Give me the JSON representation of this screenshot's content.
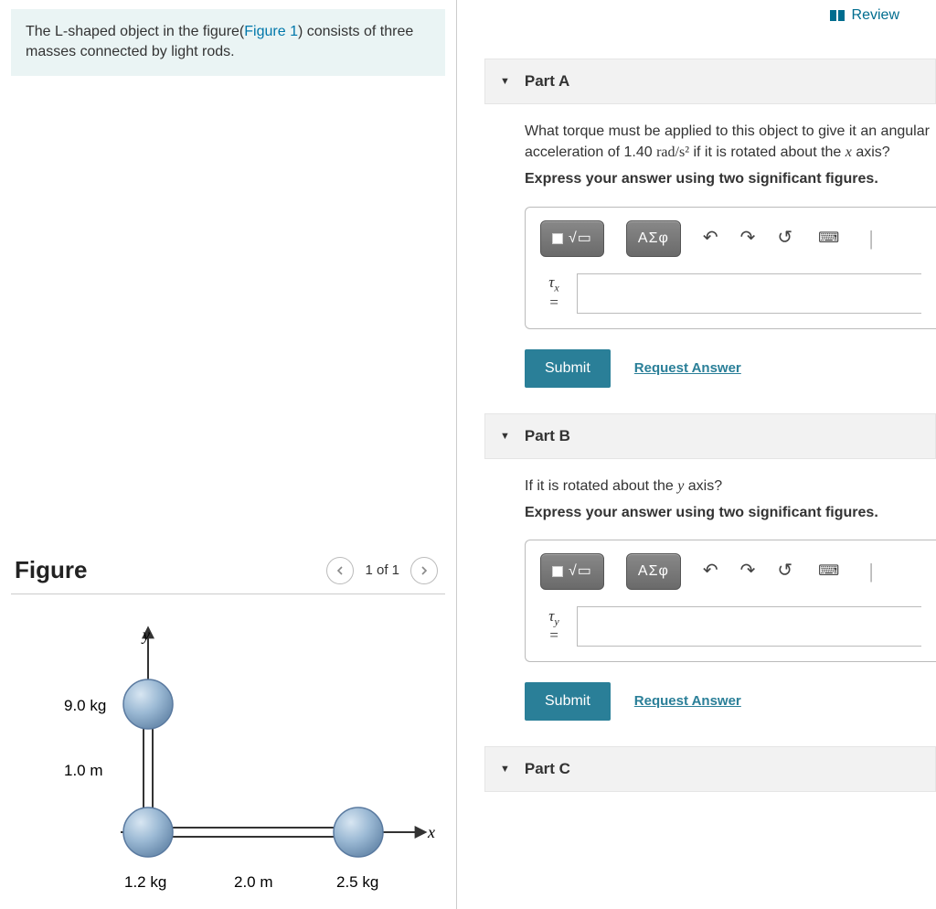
{
  "problem": {
    "text_pre": "The L-shaped object in the figure(",
    "figure_ref": "Figure 1",
    "text_post": ") consists of three masses connected by light rods."
  },
  "figure": {
    "title": "Figure",
    "pager": "1 of 1",
    "labels": {
      "y_axis": "y",
      "x_axis": "x",
      "mass_top": "9.0 kg",
      "mass_origin": "1.2 kg",
      "mass_right": "2.5 kg",
      "len_vert": "1.0 m",
      "len_horiz": "2.0 m"
    }
  },
  "review_label": "Review",
  "toolbar": {
    "math_label": "√▭",
    "greek_label": "ΑΣφ"
  },
  "parts": {
    "a": {
      "title": "Part A",
      "question_1": "What torque must be applied to this object to give it an angular acceleration of 1.40 ",
      "question_units": "rad/s²",
      "question_2": " if it is rotated about the ",
      "question_axis": "x",
      "question_3": " axis?",
      "instruction": "Express your answer using two significant figures.",
      "var": "τ",
      "var_sub": "x"
    },
    "b": {
      "title": "Part B",
      "question_1": "If it is rotated about the ",
      "question_axis": "y",
      "question_2": " axis?",
      "instruction": "Express your answer using two significant figures.",
      "var": "τ",
      "var_sub": "y"
    },
    "c": {
      "title": "Part C"
    }
  },
  "buttons": {
    "submit": "Submit",
    "request": "Request Answer"
  },
  "chart_data": {
    "type": "diagram",
    "description": "L-shaped object: three point masses on light rods along x and y axes",
    "masses": [
      {
        "label": "top",
        "mass_kg": 9.0,
        "x_m": 0.0,
        "y_m": 1.0
      },
      {
        "label": "origin",
        "mass_kg": 1.2,
        "x_m": 0.0,
        "y_m": 0.0
      },
      {
        "label": "right",
        "mass_kg": 2.5,
        "x_m": 2.0,
        "y_m": 0.0
      }
    ],
    "rods": [
      {
        "from": "origin",
        "to": "top",
        "length_m": 1.0,
        "axis": "y"
      },
      {
        "from": "origin",
        "to": "right",
        "length_m": 2.0,
        "axis": "x"
      }
    ],
    "angular_acceleration_rad_per_s2": 1.4
  }
}
